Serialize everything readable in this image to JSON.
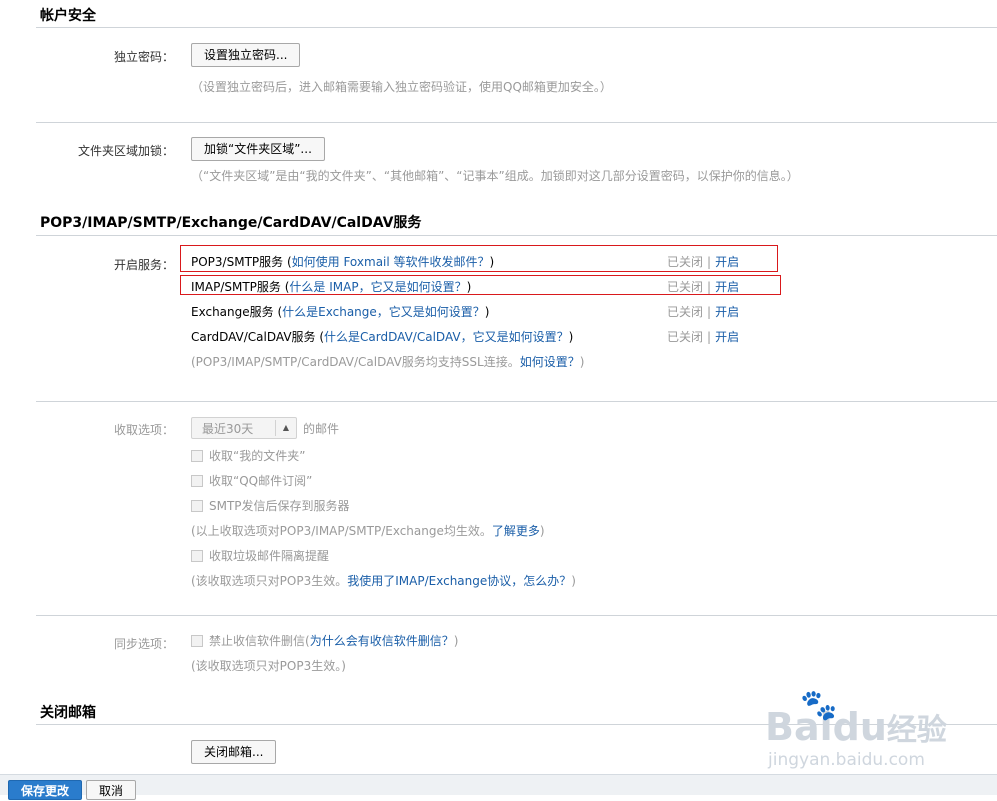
{
  "sections": {
    "account_security": "帐户安全",
    "protocols": "POP3/IMAP/SMTP/Exchange/CardDAV/CalDAV服务",
    "close_mailbox": "关闭邮箱"
  },
  "independent_password": {
    "label": "独立密码：",
    "button": "设置独立密码...",
    "hint": "（设置独立密码后，进入邮箱需要输入独立密码验证，使用QQ邮箱更加安全。）"
  },
  "folder_lock": {
    "label": "文件夹区域加锁：",
    "button": "加锁“文件夹区域”...",
    "hint": "（“文件夹区域”是由“我的文件夹”、“其他邮箱”、“记事本”组成。加锁即对这几部分设置密码，以保护你的信息。）"
  },
  "services": {
    "label": "开启服务：",
    "items": [
      {
        "name": "POP3/SMTP服务",
        "paren_open": " (",
        "link": "如何使用 Foxmail 等软件收发邮件？",
        "paren_close": ")",
        "status": "已关闭",
        "sep": "|",
        "action": "开启"
      },
      {
        "name": "IMAP/SMTP服务",
        "paren_open": " (",
        "link": "什么是 IMAP，它又是如何设置？",
        "paren_close": ")",
        "status": "已关闭",
        "sep": "|",
        "action": "开启"
      },
      {
        "name": "Exchange服务",
        "paren_open": " (",
        "link": "什么是Exchange，它又是如何设置？",
        "paren_close": ")",
        "status": "已关闭",
        "sep": "|",
        "action": "开启"
      },
      {
        "name": "CardDAV/CalDAV服务",
        "paren_open": " (",
        "link": "什么是CardDAV/CalDAV，它又是如何设置？",
        "paren_close": ")",
        "status": "已关闭",
        "sep": "|",
        "action": "开启"
      }
    ],
    "ssl_hint_prefix": "(POP3/IMAP/SMTP/CardDAV/CalDAV服务均支持SSL连接。",
    "ssl_hint_link": "如何设置？",
    "ssl_hint_suffix": ")"
  },
  "receive": {
    "label": "收取选项：",
    "select_value": "最近30天",
    "select_suffix": "的邮件",
    "opt1": "收取“我的文件夹”",
    "opt2": "收取“QQ邮件订阅”",
    "opt3": "SMTP发信后保存到服务器",
    "hint1_prefix": "(以上收取选项对POP3/IMAP/SMTP/Exchange均生效。",
    "hint1_link": "了解更多",
    "hint1_suffix": ")",
    "opt4": "收取垃圾邮件隔离提醒",
    "hint2_prefix": "(该收取选项只对POP3生效。",
    "hint2_link": "我使用了IMAP/Exchange协议，怎么办？",
    "hint2_suffix": ")"
  },
  "sync": {
    "label": "同步选项：",
    "opt": "禁止收信软件删信",
    "paren_open": " (",
    "link": "为什么会有收信软件删信？",
    "paren_close": ")",
    "hint": "(该收取选项只对POP3生效。)"
  },
  "close": {
    "button": "关闭邮箱..."
  },
  "footer": {
    "save": "保存更改",
    "cancel": "取消"
  },
  "watermark": {
    "brand": "Baidu",
    "brand_cn": "经验",
    "url": "jingyan.baidu.com"
  },
  "colors": {
    "link": "#1a5ea8",
    "highlight_box": "#d9191c",
    "primary_button": "#2a7ccc"
  }
}
